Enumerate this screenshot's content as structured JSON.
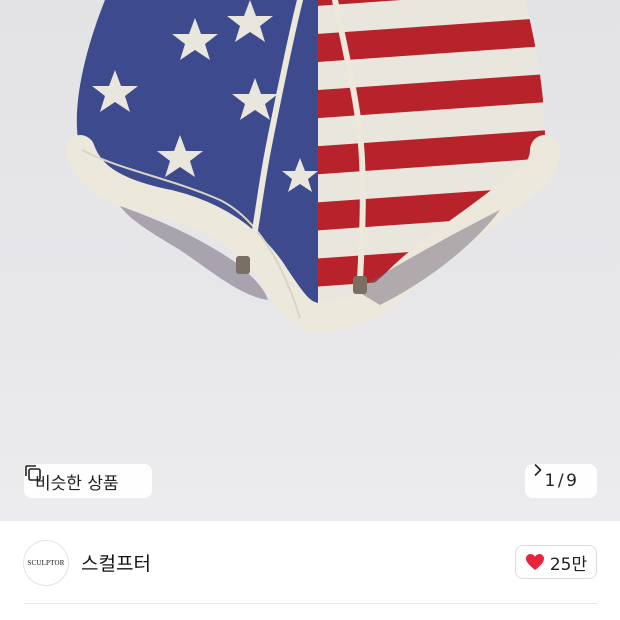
{
  "product": {
    "image_description": "",
    "similar_label": "비슷한 상품",
    "current_page": "1",
    "page_separator": "/",
    "total_pages": "9"
  },
  "brand": {
    "logo_text": "SCULPTOR",
    "name": "스컬프터"
  },
  "like": {
    "count": "25만"
  },
  "colors": {
    "heart": "#e8243c",
    "background": "#e6e6e9"
  },
  "icons": {
    "similar": "similar-products-icon",
    "next": "chevron-right-icon",
    "like": "heart-icon"
  }
}
